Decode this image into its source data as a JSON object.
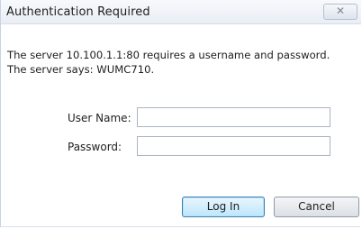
{
  "dialog": {
    "title": "Authentication Required",
    "close_glyph": "✕",
    "message_line1": "The server 10.100.1.1:80 requires a username and password.",
    "message_line2": "The server says: WUMC710."
  },
  "form": {
    "username_label": "User Name:",
    "username_value": "",
    "password_label": "Password:",
    "password_value": ""
  },
  "buttons": {
    "login": "Log In",
    "cancel": "Cancel"
  },
  "colors": {
    "accent": "#3c7fb1",
    "titlebar": "#e9eef5"
  }
}
